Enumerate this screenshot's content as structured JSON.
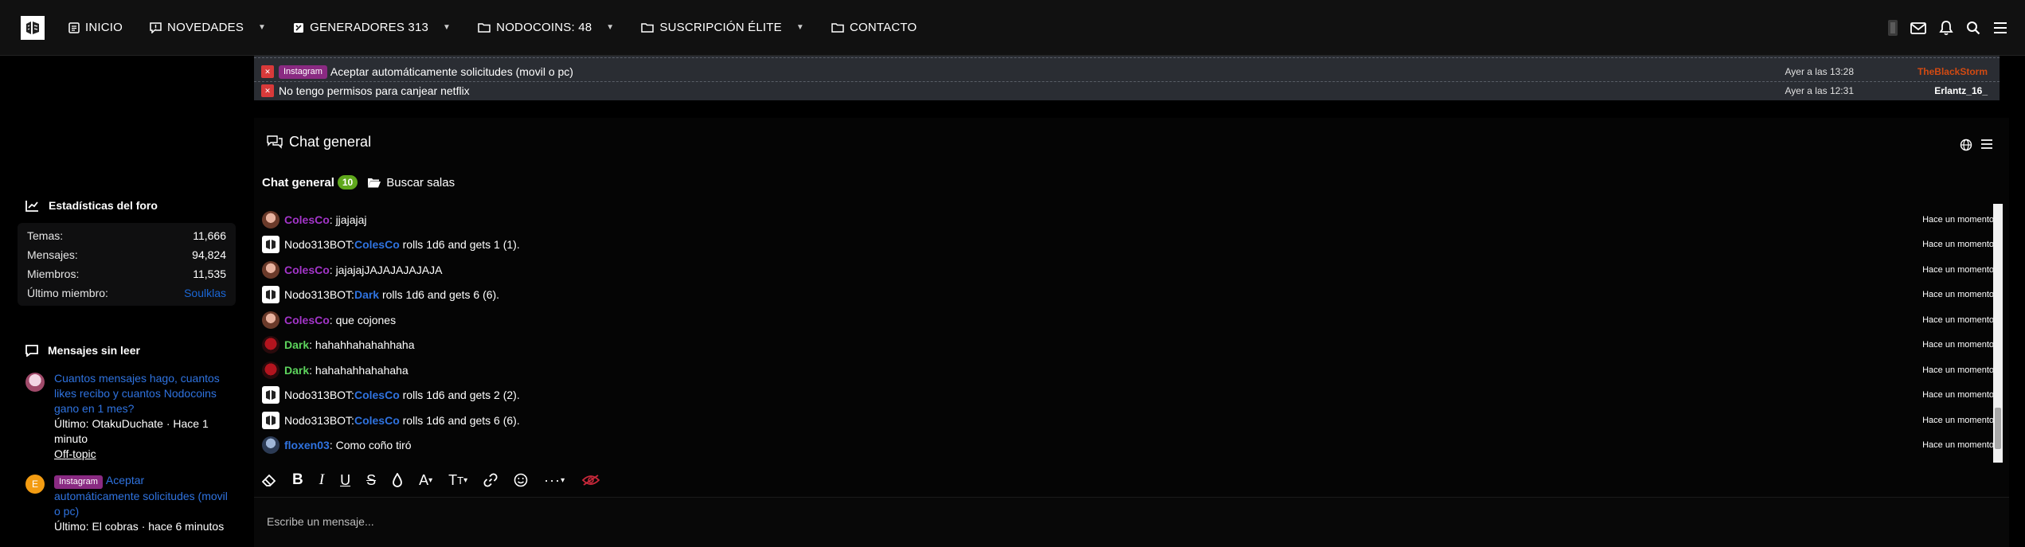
{
  "nav": {
    "items": [
      {
        "label": "INICIO",
        "icon": "document-icon",
        "dropdown": false
      },
      {
        "label": "NOVEDADES",
        "icon": "chat-bubble-icon",
        "dropdown": true
      },
      {
        "label": "GENERADORES 313",
        "icon": "generator-icon",
        "dropdown": true
      },
      {
        "label": "NODOCOINS: 48",
        "icon": "folder-icon",
        "dropdown": true
      },
      {
        "label": "SUSCRIPCIÓN ÉLITE",
        "icon": "folder-icon",
        "dropdown": true
      },
      {
        "label": "CONTACTO",
        "icon": "folder-icon",
        "dropdown": false
      }
    ],
    "right_icons": [
      "avatar-icon",
      "mail-icon",
      "bell-icon",
      "search-icon",
      "menu-icon"
    ]
  },
  "sidebar": {
    "stats": {
      "title": "Estadísticas del foro",
      "rows": [
        {
          "label": "Temas:",
          "value": "11,666"
        },
        {
          "label": "Mensajes:",
          "value": "94,824"
        },
        {
          "label": "Miembros:",
          "value": "11,535"
        },
        {
          "label": "Último miembro:",
          "value": "Soulklas"
        }
      ]
    },
    "unread": {
      "title": "Mensajes sin leer",
      "items": [
        {
          "badge": "",
          "title": "Cuantos mensajes hago, cuantos likes recibo y cuantos Nodocoins gano en 1 mes?",
          "meta": "Último: OtakuDuchate · Hace 1 minuto",
          "forum": "Off-topic"
        },
        {
          "badge": "Instagram",
          "title": "Aceptar automáticamente solicitudes (movil o pc)",
          "meta": "Último: El cobras · hace 6 minutos",
          "forum": ""
        }
      ]
    }
  },
  "threads": [
    {
      "badge": "Instagram",
      "title": "Aceptar automáticamente solicitudes (movil o pc)",
      "when": "Ayer a las 13:28",
      "who": "TheBlackStorm",
      "who_color": "#d24a12"
    },
    {
      "badge": "",
      "title": "No tengo permisos para canjear netflix",
      "when": "Ayer a las 12:31",
      "who": "Erlantz_16_",
      "who_color": "#ffffff"
    }
  ],
  "chat": {
    "title": "Chat general",
    "room": {
      "name": "Chat general",
      "count": "10",
      "search_label": "Buscar salas"
    },
    "messages": [
      {
        "kind": "user",
        "user": "ColesCo",
        "user_color": "purple",
        "text": ": jjajajaj",
        "ts": "Hace un momento"
      },
      {
        "kind": "bot",
        "user": "Nodo313BOT:",
        "target": "ColesCo",
        "text": "rolls 1d6 and gets 1 (1).",
        "ts": "Hace un momento"
      },
      {
        "kind": "user",
        "user": "ColesCo",
        "user_color": "purple",
        "text": ": jajajajJAJAJAJAJAJA",
        "ts": "Hace un momento"
      },
      {
        "kind": "bot",
        "user": "Nodo313BOT:",
        "target": "Dark",
        "text": "rolls 1d6 and gets 6 (6).",
        "ts": "Hace un momento"
      },
      {
        "kind": "user",
        "user": "ColesCo",
        "user_color": "purple",
        "text": ": que cojones",
        "ts": "Hace un momento"
      },
      {
        "kind": "user",
        "user": "Dark",
        "user_color": "green",
        "text": ": hahahhahahahhaha",
        "ts": "Hace un momento"
      },
      {
        "kind": "user",
        "user": "Dark",
        "user_color": "green",
        "text": ": hahahahhahahaha",
        "ts": "Hace un momento"
      },
      {
        "kind": "bot",
        "user": "Nodo313BOT:",
        "target": "ColesCo",
        "text": "rolls 1d6 and gets 2 (2).",
        "ts": "Hace un momento"
      },
      {
        "kind": "bot",
        "user": "Nodo313BOT:",
        "target": "ColesCo",
        "text": "rolls 1d6 and gets 6 (6).",
        "ts": "Hace un momento"
      },
      {
        "kind": "user",
        "user": "floxen03",
        "user_color": "blue",
        "text": ": Como coño tiró",
        "ts": "Hace un momento"
      }
    ],
    "toolbar_icons": [
      "eraser-icon",
      "bold-icon",
      "italic-icon",
      "underline-icon",
      "strikethrough-icon",
      "color-drop-icon",
      "font-family-icon",
      "font-size-icon",
      "link-icon",
      "emoji-icon",
      "more-icon",
      "hide-icon"
    ],
    "input_placeholder": "Escribe un mensaje..."
  },
  "colors": {
    "purple": "#a335c9",
    "green": "#5dd45d",
    "blue": "#2f73e0",
    "badge": "#5fa81c"
  }
}
